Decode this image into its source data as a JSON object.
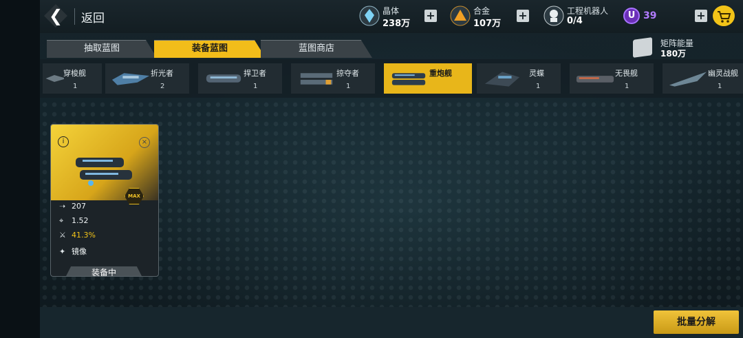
{
  "header": {
    "back_label": "返回",
    "resources": [
      {
        "name": "晶体",
        "value": "238万",
        "icon": "crystal-icon"
      },
      {
        "name": "合金",
        "value": "107万",
        "icon": "alloy-icon"
      },
      {
        "name": "工程机器人",
        "value": "0/4",
        "icon": "robot-icon"
      }
    ],
    "premium_value": "39",
    "premium_letter": "U"
  },
  "tabs": [
    {
      "label": "抽取蓝图",
      "active": false
    },
    {
      "label": "装备蓝图",
      "active": true
    },
    {
      "label": "蓝图商店",
      "active": false
    }
  ],
  "matrix_energy": {
    "name": "矩阵能量",
    "value": "180万"
  },
  "ships": [
    {
      "name": "穿梭舰",
      "count": "1",
      "selected": false
    },
    {
      "name": "折光者",
      "count": "2",
      "selected": false
    },
    {
      "name": "捍卫者",
      "count": "1",
      "selected": false
    },
    {
      "name": "掠夺者",
      "count": "1",
      "selected": false
    },
    {
      "name": "重炮舰",
      "count": "",
      "selected": true
    },
    {
      "name": "灵蝶",
      "count": "1",
      "selected": false
    },
    {
      "name": "无畏舰",
      "count": "1",
      "selected": false
    },
    {
      "name": "幽灵战舰",
      "count": "1",
      "selected": false
    }
  ],
  "card": {
    "max_label": "MAX",
    "stat_speed": "207",
    "stat_range": "1.52",
    "stat_percent": "41.3%",
    "stat_skill": "镜像",
    "status": "装备中"
  },
  "batch_button": "批量分解",
  "colors": {
    "accent": "#f2bd1a",
    "premium": "#b27cff"
  }
}
